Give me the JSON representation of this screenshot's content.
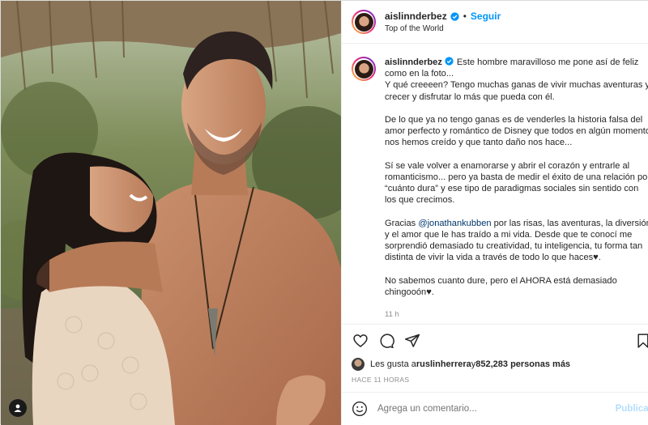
{
  "post": {
    "username": "aislinnderbez",
    "follow_label": "Seguir",
    "dot": "•",
    "location": "Top of the World",
    "caption_paragraphs": [
      "Este hombre maravilloso me pone así de feliz como en la foto...\nY qué creeeen? Tengo muchas ganas de vivir muchas aventuras y crecer y disfrutar lo más que pueda con él.",
      "De lo que ya no tengo ganas es de venderles la historia falsa del amor perfecto y romántico de Disney que todos en algún momento nos hemos creído y que tanto daño nos hace...",
      "Sí se vale volver a enamorarse y abrir el corazón y entrarle al romanticismo... pero ya basta de medir el éxito de una relación por “cuánto dura” y ese tipo de paradigmas sociales sin sentido con los que crecimos."
    ],
    "thanks_prefix": "Gracias ",
    "thanks_mention": "@jonathankubben",
    "thanks_rest": " por las risas, las aventuras, la diversión y el amor que le has traído a mi vida. Desde que te conocí me sorprendió demasiado tu creatividad, tu inteligencia, tu forma tan distinta de vivir la vida a través de todo lo que haces♥.",
    "last_paragraph": "No sabemos cuanto dure, pero el AHORA está demasiado chingooón♥.",
    "caption_time": "11 h",
    "likes_prefix": "Les gusta a ",
    "likes_user": "ruslinherrera",
    "likes_mid": " y ",
    "likes_count": "852,283 personas más",
    "posted_ago": "HACE 11 HORAS",
    "comment_placeholder": "Agrega un comentario...",
    "publish_label": "Publicar"
  },
  "icons": {
    "verified": "verified-badge-icon",
    "like": "heart-icon",
    "comment": "comment-bubble-icon",
    "share": "paper-plane-icon",
    "save": "bookmark-icon",
    "emoji": "smiley-icon",
    "user_tag": "user-tag-icon"
  },
  "colors": {
    "link_blue": "#0095f6",
    "mention_blue": "#00376b",
    "muted": "#8e8e8e",
    "publish_disabled": "#b2dffc"
  }
}
